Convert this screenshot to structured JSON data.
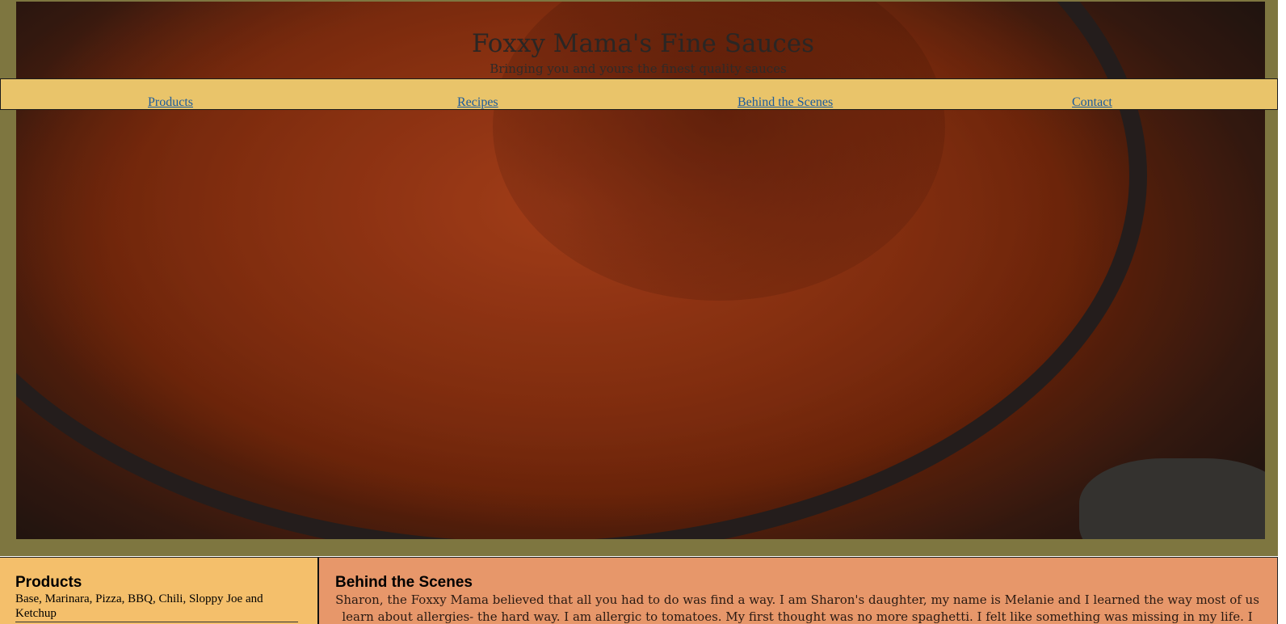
{
  "header": {
    "title": "Foxxy Mama's Fine Sauces",
    "tagline": "Bringing you and yours the finest quality sauces"
  },
  "nav": {
    "items": [
      {
        "label": "Products"
      },
      {
        "label": "Recipes"
      },
      {
        "label": "Behind the Scenes"
      },
      {
        "label": "Contact"
      }
    ]
  },
  "products": {
    "title": "Products",
    "text": "Base, Marinara, Pizza, BBQ, Chili, Sloppy Joe and Ketchup"
  },
  "behind_scenes": {
    "title": "Behind the Scenes",
    "text": "Sharon, the Foxxy Mama believed that all you had to do was find a way. I am Sharon's daughter, my name is Melanie and I learned the way most of us learn about allergies- the hard way. I am allergic to tomatoes. My first thought was no more spaghetti. I felt like something was missing in my life. I"
  },
  "colors": {
    "frame": "#7e7640",
    "nav_bg": "#e9c46a",
    "link": "#1b5b9e",
    "products_bg": "#f4bf6b",
    "scenes_bg": "#e7976a"
  }
}
